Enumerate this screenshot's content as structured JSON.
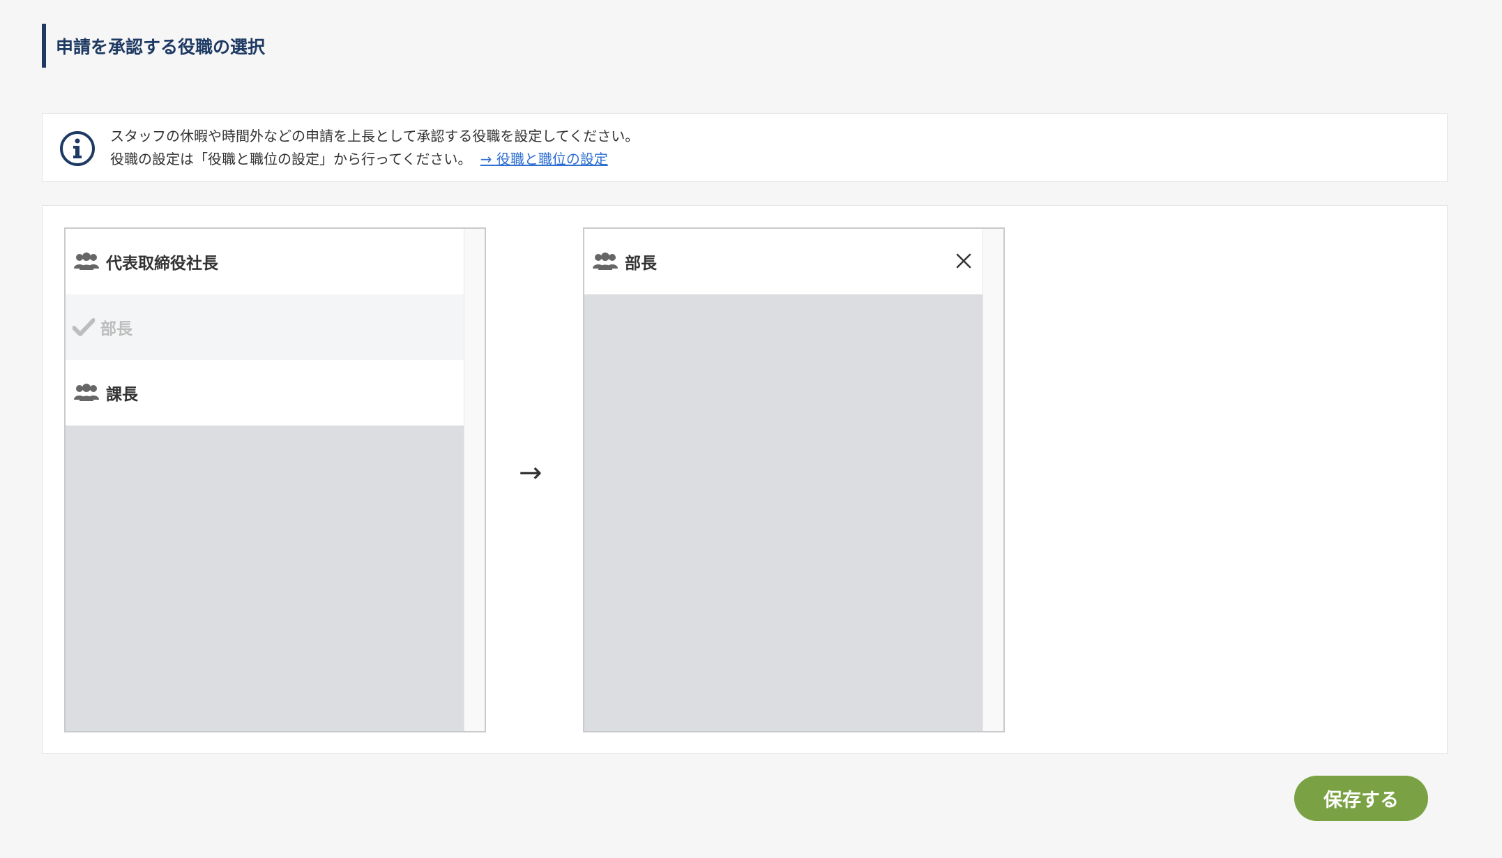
{
  "page_title": "申請を承認する役職の選択",
  "info": {
    "line1": "スタッフの休暇や時間外などの申請を上長として承認する役職を設定してください。",
    "line2": "役職の設定は「役職と職位の設定」から行ってください。",
    "link_label": "→ 役職と職位の設定"
  },
  "available_list": {
    "items": [
      {
        "label": "代表取締役社長",
        "icon": "people-icon",
        "state": "available"
      },
      {
        "label": "部長",
        "icon": "check-icon",
        "state": "selected-disabled"
      },
      {
        "label": "課長",
        "icon": "people-icon",
        "state": "available"
      }
    ]
  },
  "transfer_arrow": "→",
  "selected_list": {
    "items": [
      {
        "label": "部長",
        "icon": "people-icon",
        "remove_icon": "close-icon"
      }
    ]
  },
  "save_button_label": "保存する",
  "colors": {
    "title": "#1e3a63",
    "link": "#2f6fd1",
    "save_button": "#7aa143",
    "list_empty_bg": "#dcdde0"
  }
}
